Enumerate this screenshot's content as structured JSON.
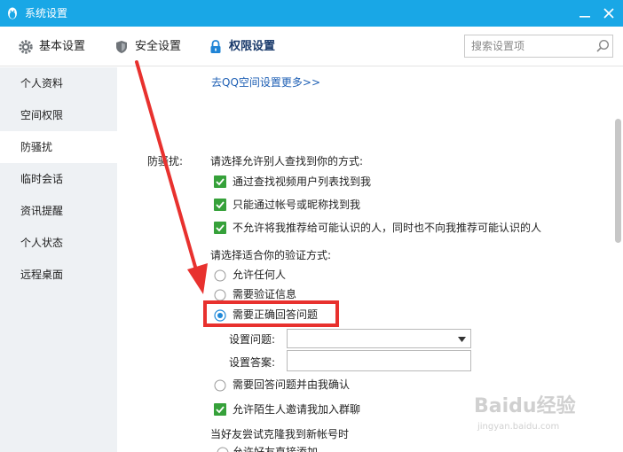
{
  "window": {
    "title": "系统设置"
  },
  "tabs": [
    {
      "label": "基本设置",
      "icon": "gear-icon"
    },
    {
      "label": "安全设置",
      "icon": "shield-icon"
    },
    {
      "label": "权限设置",
      "icon": "lock-icon",
      "active": true
    }
  ],
  "search": {
    "placeholder": "搜索设置项"
  },
  "sidebar": {
    "items": [
      {
        "label": "个人资料"
      },
      {
        "label": "空间权限"
      },
      {
        "label": "防骚扰",
        "active": true
      },
      {
        "label": "临时会话"
      },
      {
        "label": "资讯提醒"
      },
      {
        "label": "个人状态"
      },
      {
        "label": "远程桌面"
      }
    ]
  },
  "content": {
    "more_link": "去QQ空间设置更多>>",
    "section_label": "防骚扰:",
    "find_prompt": "请选择允许别人查找到你的方式:",
    "find_options": [
      {
        "label": "通过查找视频用户列表找到我",
        "checked": true
      },
      {
        "label": "只能通过帐号或昵称找到我",
        "checked": true
      },
      {
        "label": "不允许将我推荐给可能认识的人，同时也不向我推荐可能认识的人",
        "checked": true
      }
    ],
    "verify_prompt": "请选择适合你的验证方式:",
    "verify_options": [
      {
        "label": "允许任何人",
        "selected": false
      },
      {
        "label": "需要验证信息",
        "selected": false
      },
      {
        "label": "需要正确回答问题",
        "selected": true
      }
    ],
    "question_label": "设置问题:",
    "question_value": "",
    "answer_label": "设置答案:",
    "answer_value": "",
    "confirm_option": {
      "label": "需要回答问题并由我确认",
      "selected": false
    },
    "group_invite": {
      "label": "允许陌生人邀请我加入群聊",
      "checked": true
    },
    "clone_prompt": "当好友尝试克隆我到新帐号时",
    "cutoff_option": "允许好友直接添加"
  },
  "watermark": {
    "logo": "Baidu经验",
    "url": "jingyan.baidu.com"
  },
  "colors": {
    "titlebar": "#19a7e6",
    "checkbox": "#36a13a",
    "radio": "#1e88d8",
    "highlight": "#e8312e",
    "link": "#1e5fb4"
  }
}
